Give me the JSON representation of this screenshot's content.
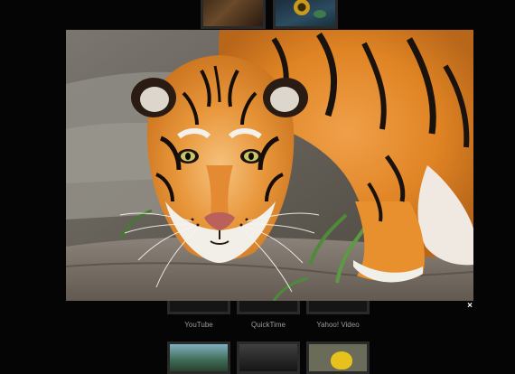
{
  "gallery": {
    "captions": [
      "YouTube",
      "QuickTime",
      "Yahoo! Video"
    ]
  },
  "lightbox": {
    "image_icon": "tiger-photo",
    "close_label": "×"
  }
}
